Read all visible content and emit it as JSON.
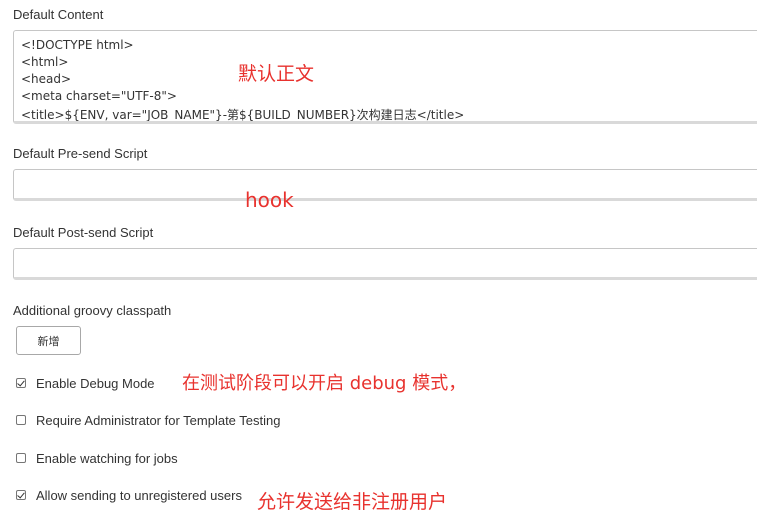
{
  "default_content": {
    "label": "Default Content",
    "lines": [
      "<!DOCTYPE html>",
      "<html>",
      "<head>",
      "<meta charset=\"UTF-8\">",
      "<title>${ENV, var=\"JOB_NAME\"}-第${BUILD_NUMBER}次构建日志</title>"
    ],
    "annotation": "默认正文"
  },
  "pre_send_script": {
    "label": "Default Pre-send Script",
    "value": "",
    "annotation": "hook"
  },
  "post_send_script": {
    "label": "Default Post-send Script",
    "value": ""
  },
  "classpath": {
    "label": "Additional groovy classpath",
    "add_button_label": "新增"
  },
  "options": [
    {
      "label": "Enable Debug Mode",
      "checked": true,
      "annotation": "在测试阶段可以开启 debug 模式，"
    },
    {
      "label": "Require Administrator for Template Testing",
      "checked": false
    },
    {
      "label": "Enable watching for jobs",
      "checked": false
    },
    {
      "label": "Allow sending to unregistered users",
      "checked": true,
      "annotation": "允许发送给非注册用户"
    }
  ],
  "colors": {
    "annotation": "#e8322e",
    "text": "#333333",
    "border": "#c6c6c6"
  }
}
